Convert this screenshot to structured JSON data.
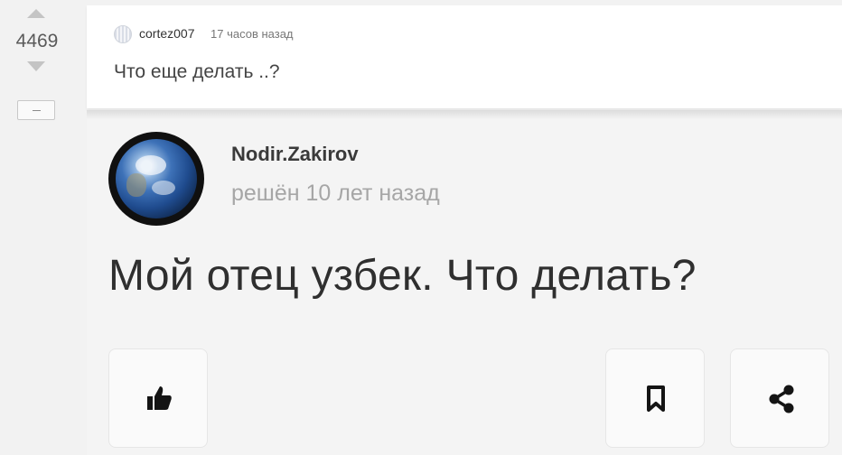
{
  "vote": {
    "score": "4469",
    "collapse_label": "–"
  },
  "post": {
    "author": "cortez007",
    "time": "17 часов назад",
    "text": "Что еще делать ..?"
  },
  "meme": {
    "username": "Nodir.Zakirov",
    "time": "решён 10 лет назад",
    "question": "Мой отец узбек. Что делать?",
    "buttons": [
      "thumbs-up-icon",
      "bookmark-icon",
      "share-icon"
    ]
  },
  "colors": {
    "background": "#f2f2f2",
    "card": "#ffffff",
    "text": "#444444",
    "muted": "#a6a6a6"
  }
}
